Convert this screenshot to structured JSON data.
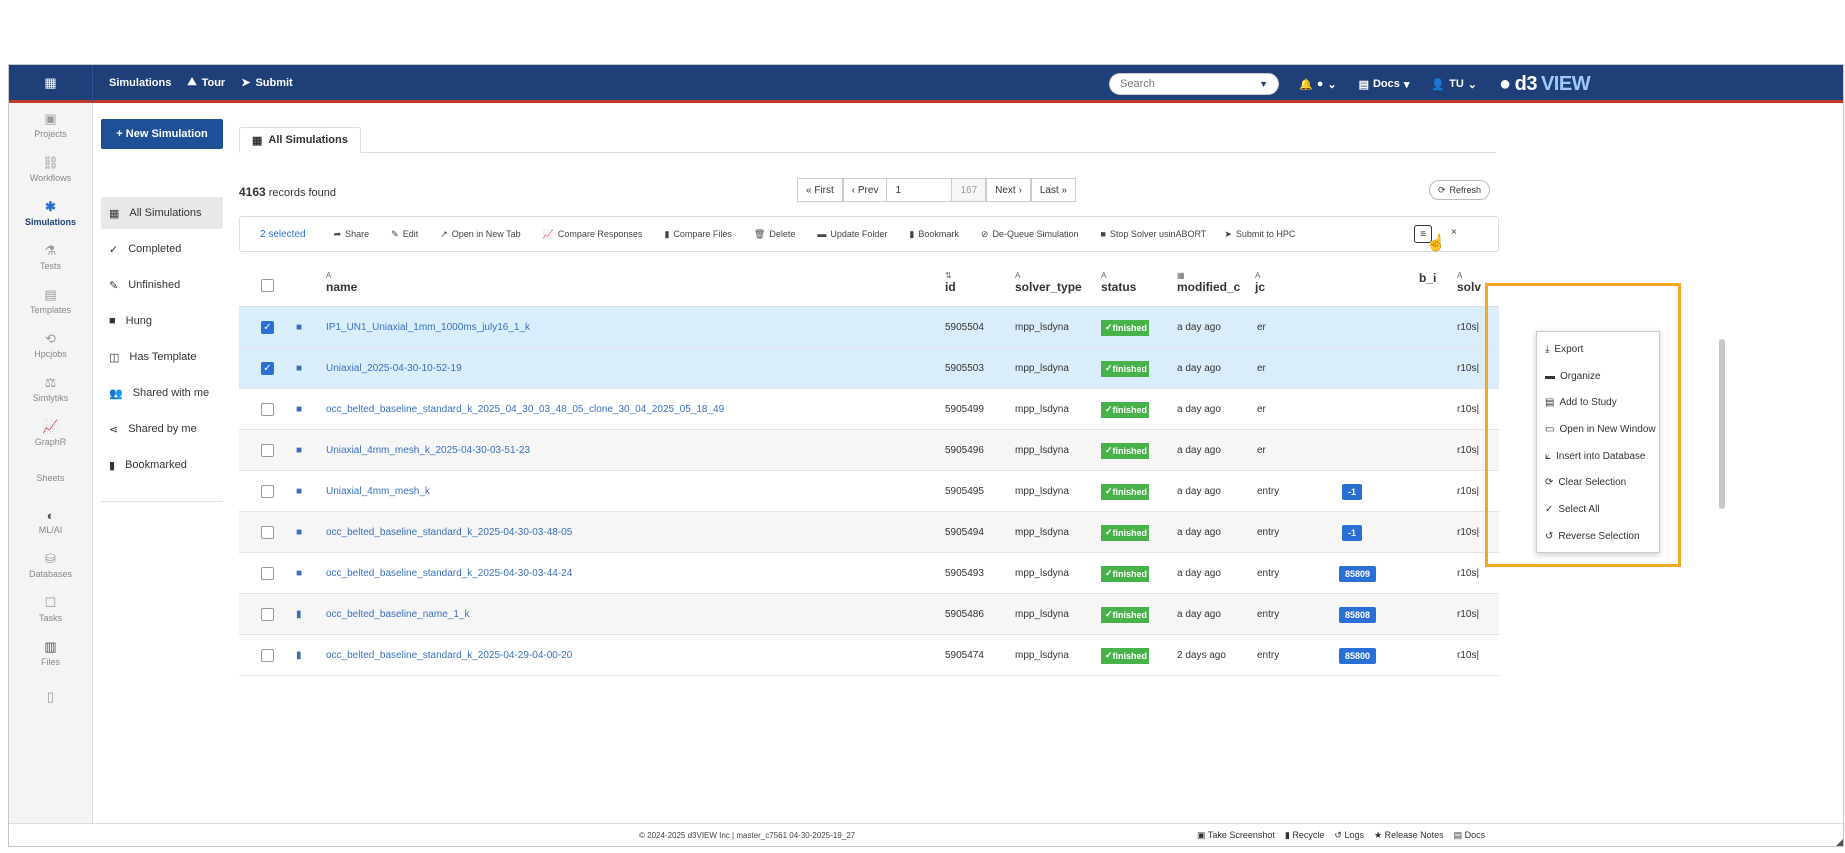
{
  "topbar": {
    "simulations": "Simulations",
    "tour": "Tour",
    "submit": "Submit",
    "search_placeholder": "Search",
    "docs": "Docs",
    "user": "TU",
    "logo_prefix": "d3",
    "logo_suffix": "VIEW"
  },
  "rail": [
    {
      "label": "Projects",
      "icon": "folder-icon"
    },
    {
      "label": "Workflows",
      "icon": "workflow-icon"
    },
    {
      "label": "Simulations",
      "icon": "simulations-icon"
    },
    {
      "label": "Tests",
      "icon": "flask-icon"
    },
    {
      "label": "Templates",
      "icon": "template-icon"
    },
    {
      "label": "Hpcjobs",
      "icon": "hpc-icon"
    },
    {
      "label": "Simlytiks",
      "icon": "simlytiks-icon"
    },
    {
      "label": "GraphR",
      "icon": "chart-icon"
    },
    {
      "label": "Sheets",
      "icon": "sheet-icon"
    },
    {
      "label": "ML/AI",
      "icon": "brain-icon"
    },
    {
      "label": "Databases",
      "icon": "database-icon"
    },
    {
      "label": "Tasks",
      "icon": "tasks-icon"
    },
    {
      "label": "Files",
      "icon": "files-icon"
    }
  ],
  "sidenav": {
    "new_button": "+ New Simulation",
    "items": [
      {
        "label": "All Simulations",
        "icon": "table-icon"
      },
      {
        "label": "Completed",
        "icon": "check-icon"
      },
      {
        "label": "Unfinished",
        "icon": "edit-icon"
      },
      {
        "label": "Hung",
        "icon": "square-icon"
      },
      {
        "label": "Has Template",
        "icon": "template-icon"
      },
      {
        "label": "Shared with me",
        "icon": "users-icon"
      },
      {
        "label": "Shared by me",
        "icon": "share-icon"
      },
      {
        "label": "Bookmarked",
        "icon": "bookmark-icon"
      }
    ]
  },
  "main": {
    "tab": "All Simulations",
    "records_count": "4163",
    "records_label": "records found",
    "pager": {
      "first": "« First",
      "prev": "‹ Prev",
      "page": "1",
      "total": "167",
      "next": "Next ›",
      "last": "Last »"
    },
    "refresh": "Refresh",
    "toolbar": {
      "selected": "2 selected",
      "share": "Share",
      "edit": "Edit",
      "open_new_tab": "Open in New Tab",
      "compare_responses": "Compare Responses",
      "compare_files": "Compare Files",
      "delete": "Delete",
      "update_folder": "Update Folder",
      "bookmark": "Bookmark",
      "dequeue": "De-Queue Simulation",
      "stop_solver": "Stop Solver usin",
      "abort": "ABORT",
      "submit_hpc": "Submit to HPC",
      "close": "×"
    },
    "columns": {
      "name": "name",
      "id": "id",
      "solver_type": "solver_type",
      "status": "status",
      "modified": "modified_c",
      "job": "jc",
      "jobid": "b_i",
      "solver": "solv"
    },
    "rows": [
      {
        "name": "IP1_UN1_Uniaxial_1mm_1000ms_july16_1_k",
        "id": "5905504",
        "solver_type": "mpp_lsdyna",
        "status": "finished",
        "modified": "a day ago",
        "job": "er",
        "jobid": "",
        "solver": "r10s|",
        "checked": true,
        "type": "folder"
      },
      {
        "name": "Uniaxial_2025-04-30-10-52-19",
        "id": "5905503",
        "solver_type": "mpp_lsdyna",
        "status": "finished",
        "modified": "a day ago",
        "job": "er",
        "jobid": "",
        "solver": "r10s|",
        "checked": true,
        "type": "folder"
      },
      {
        "name": "occ_belted_baseline_standard_k_2025_04_30_03_48_05_clone_30_04_2025_05_18_49",
        "id": "5905499",
        "solver_type": "mpp_lsdyna",
        "status": "finished",
        "modified": "a day ago",
        "job": "er",
        "jobid": "",
        "solver": "r10s|",
        "checked": false,
        "type": "folder"
      },
      {
        "name": "Uniaxial_4mm_mesh_k_2025-04-30-03-51-23",
        "id": "5905496",
        "solver_type": "mpp_lsdyna",
        "status": "finished",
        "modified": "a day ago",
        "job": "er",
        "jobid": "",
        "solver": "r10s|",
        "checked": false,
        "type": "folder"
      },
      {
        "name": "Uniaxial_4mm_mesh_k",
        "id": "5905495",
        "solver_type": "mpp_lsdyna",
        "status": "finished",
        "modified": "a day ago",
        "job": "entry",
        "jobid": "-1",
        "solver": "r10s|",
        "checked": false,
        "type": "folder"
      },
      {
        "name": "occ_belted_baseline_standard_k_2025-04-30-03-48-05",
        "id": "5905494",
        "solver_type": "mpp_lsdyna",
        "status": "finished",
        "modified": "a day ago",
        "job": "entry",
        "jobid": "-1",
        "solver": "r10s|",
        "checked": false,
        "type": "folder"
      },
      {
        "name": "occ_belted_baseline_standard_k_2025-04-30-03-44-24",
        "id": "5905493",
        "solver_type": "mpp_lsdyna",
        "status": "finished",
        "modified": "a day ago",
        "job": "entry",
        "jobid": "85809",
        "solver": "r10s|",
        "checked": false,
        "type": "folder"
      },
      {
        "name": "occ_belted_baseline_name_1_k",
        "id": "5905486",
        "solver_type": "mpp_lsdyna",
        "status": "finished",
        "modified": "a day ago",
        "job": "entry",
        "jobid": "85808",
        "solver": "r10s|",
        "checked": false,
        "type": "file"
      },
      {
        "name": "occ_belted_baseline_standard_k_2025-04-29-04-00-20",
        "id": "5905474",
        "solver_type": "mpp_lsdyna",
        "status": "finished",
        "modified": "2 days ago",
        "job": "entry",
        "jobid": "85800",
        "solver": "r10s|",
        "checked": false,
        "type": "file"
      }
    ],
    "dropdown": [
      {
        "label": "Export",
        "icon": "download-icon"
      },
      {
        "label": "Organize",
        "icon": "folder-icon"
      },
      {
        "label": "Add to Study",
        "icon": "study-icon"
      },
      {
        "label": "Open in New Window",
        "icon": "folder-open-icon"
      },
      {
        "label": "Insert into Database",
        "icon": "chart-icon"
      },
      {
        "label": "Clear Selection",
        "icon": "refresh-icon"
      },
      {
        "label": "Select All",
        "icon": "check-all-icon"
      },
      {
        "label": "Reverse Selection",
        "icon": "undo-icon"
      }
    ]
  },
  "footer": {
    "copyright": "© 2024-2025 d3VIEW Inc | master_c7561 04-30-2025-19_27",
    "take_screenshot": "Take Screenshot",
    "recycle": "Recycle",
    "logs": "Logs",
    "release_notes": "Release Notes",
    "docs": "Docs"
  },
  "colors": {
    "topbar": "#1f3f78",
    "accent_red": "#c0392b",
    "primary": "#2a6fd6",
    "success": "#48b24a",
    "highlight": "#f5a623"
  }
}
